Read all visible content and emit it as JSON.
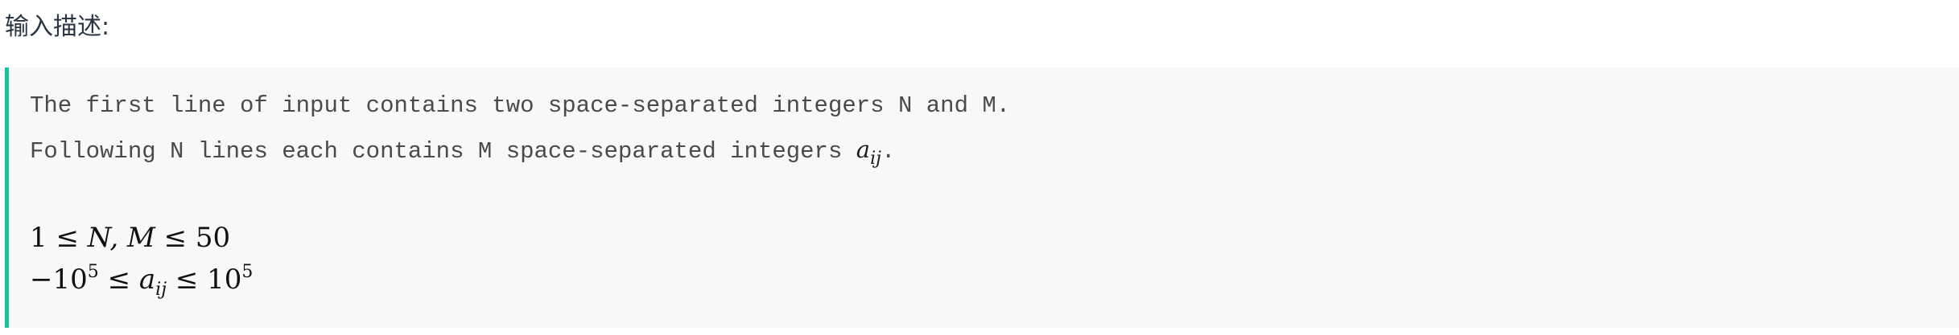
{
  "section": {
    "title": "输入描述:"
  },
  "description": {
    "line1": "The first line of input contains two space-separated integers N and M.",
    "line2_prefix": "Following N lines each contains M space-separated integers ",
    "line2_var_base": "a",
    "line2_var_sub": "ij",
    "line2_suffix": "."
  },
  "constraints": {
    "c1_left": "1",
    "c1_leq1": " ≤ ",
    "c1_vars": "N, M",
    "c1_leq2": " ≤ ",
    "c1_right": "50",
    "c2_neg_base": "−10",
    "c2_neg_exp": "5",
    "c2_leq1": " ≤ ",
    "c2_var_base": "a",
    "c2_var_sub": "ij",
    "c2_leq2": " ≤ ",
    "c2_pos_base": "10",
    "c2_pos_exp": "5"
  },
  "colors": {
    "accent_border": "#18c29a",
    "panel_bg": "#f8f8f8",
    "title_text": "#2a3646"
  }
}
